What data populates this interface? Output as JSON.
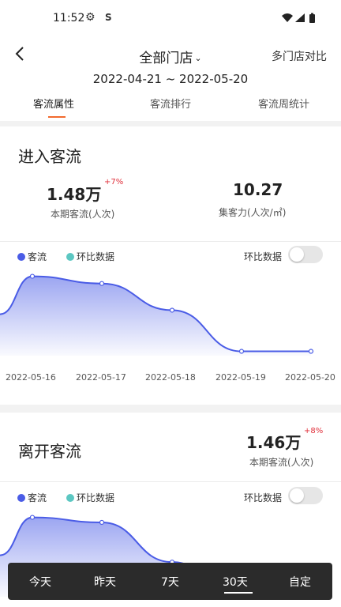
{
  "status": {
    "time": "11:52",
    "gear_icon": "gear-icon",
    "s_label": "S"
  },
  "header": {
    "store": "全部门店",
    "compare": "多门店对比",
    "date_range": "2022-04-21 ~ 2022-05-20",
    "tabs": [
      {
        "label": "客流属性",
        "active": true
      },
      {
        "label": "客流排行",
        "active": false
      },
      {
        "label": "客流周统计",
        "active": false
      }
    ]
  },
  "enter": {
    "title": "进入客流",
    "stat1": {
      "value": "1.48万",
      "change": "+7%",
      "label": "本期客流(人次)"
    },
    "stat2": {
      "value": "10.27",
      "label": "集客力(人次/㎡)"
    },
    "legend": {
      "series": "客流",
      "compare": "环比数据"
    },
    "toggle_label": "环比数据"
  },
  "exit": {
    "title": "离开客流",
    "stat1": {
      "value": "1.46万",
      "change": "+8%",
      "label": "本期客流(人次)"
    },
    "legend": {
      "series": "客流",
      "compare": "环比数据"
    },
    "toggle_label": "环比数据"
  },
  "colors": {
    "accent": "#f26a2e",
    "series": "#4a5ce6",
    "compare": "#5cc7c2",
    "increase": "#e0303b"
  },
  "chart_data": [
    {
      "type": "area",
      "categories": [
        "2022-05-16",
        "2022-05-17",
        "2022-05-18",
        "2022-05-19",
        "2022-05-20"
      ],
      "series": [
        {
          "name": "客流",
          "values": [
            1100,
            1000,
            630,
            60,
            60
          ]
        }
      ],
      "ylim": [
        0,
        1150
      ]
    },
    {
      "type": "area",
      "categories": [
        "2022-05-16",
        "2022-05-17",
        "2022-05-18",
        "2022-05-19",
        "2022-05-20"
      ],
      "series": [
        {
          "name": "客流",
          "values": [
            1100,
            1030,
            480,
            0,
            0
          ]
        }
      ],
      "ylim": [
        0,
        1150
      ]
    }
  ],
  "range_bar": {
    "options": [
      "今天",
      "昨天",
      "7天",
      "30天",
      "自定"
    ],
    "selected": "30天"
  }
}
